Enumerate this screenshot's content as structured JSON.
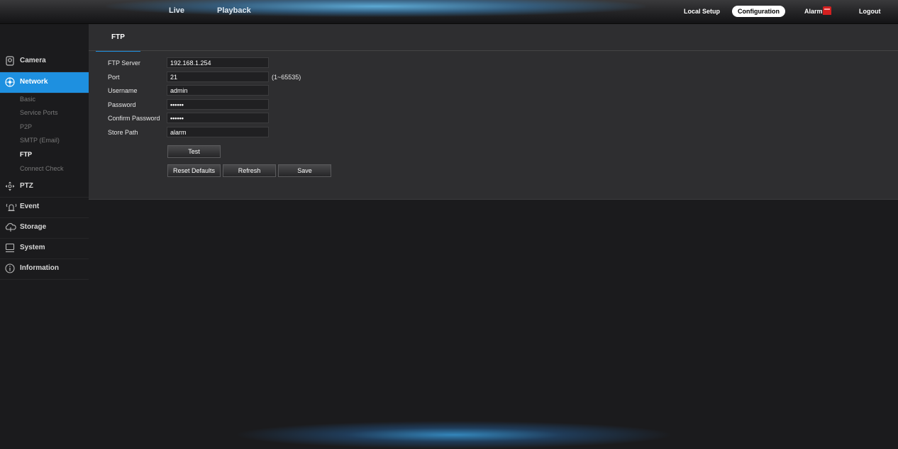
{
  "header": {
    "nav_live": "Live",
    "nav_playback": "Playback",
    "local_setup": "Local Setup",
    "configuration": "Configuration",
    "alarm": "Alarm",
    "logout": "Logout"
  },
  "sidebar": {
    "categories": [
      {
        "label": "Camera",
        "icon": "camera-icon"
      },
      {
        "label": "Network",
        "icon": "network-icon"
      },
      {
        "label": "PTZ",
        "icon": "ptz-icon"
      },
      {
        "label": "Event",
        "icon": "event-icon"
      },
      {
        "label": "Storage",
        "icon": "storage-icon"
      },
      {
        "label": "System",
        "icon": "system-icon"
      },
      {
        "label": "Information",
        "icon": "information-icon"
      }
    ],
    "network_subitems": [
      "Basic",
      "Service Ports",
      "P2P",
      "SMTP (Email)",
      "FTP",
      "Connect Check"
    ],
    "active_category": "Network",
    "active_subitem": "FTP"
  },
  "tab": {
    "label": "FTP"
  },
  "form": {
    "ftp_server_label": "FTP Server",
    "ftp_server_value": "192.168.1.254",
    "port_label": "Port",
    "port_value": "21",
    "port_range": "(1~65535)",
    "username_label": "Username",
    "username_value": "admin",
    "password_label": "Password",
    "password_value": "••••••",
    "confirm_password_label": "Confirm Password",
    "confirm_password_value": "••••••",
    "store_path_label": "Store Path",
    "store_path_value": "alarm"
  },
  "buttons": {
    "test": "Test",
    "reset_defaults": "Reset Defaults",
    "refresh": "Refresh",
    "save": "Save"
  },
  "colors": {
    "accent": "#1e90e0",
    "alarm": "#d42020"
  }
}
